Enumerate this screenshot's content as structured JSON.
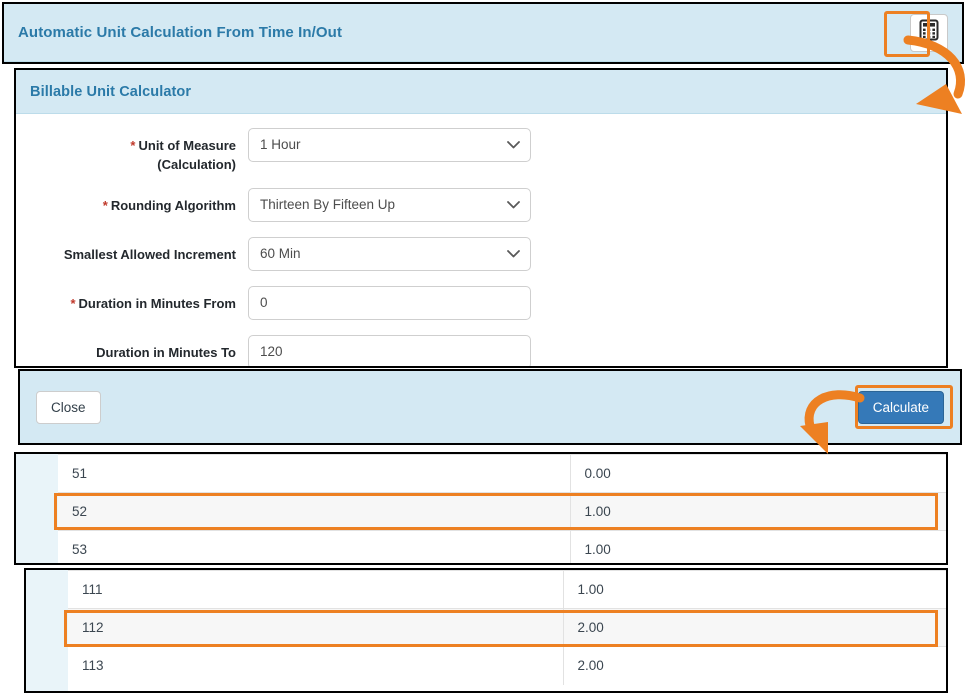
{
  "header": {
    "title": "Automatic Unit Calculation From Time In/Out",
    "calculator_icon": "calculator-icon"
  },
  "dialog": {
    "title": "Billable Unit Calculator",
    "fields": [
      {
        "label": "Unit of Measure (Calculation)",
        "label_line1": "Unit of Measure",
        "label_line2": "(Calculation)",
        "required": true,
        "type": "select",
        "value": "1 Hour"
      },
      {
        "label": "Rounding Algorithm",
        "label_line1": "Rounding Algorithm",
        "label_line2": "",
        "required": true,
        "type": "select",
        "value": "Thirteen By Fifteen Up"
      },
      {
        "label": "Smallest Allowed Increment",
        "label_line1": "Smallest Allowed Increment",
        "label_line2": "",
        "required": false,
        "type": "select",
        "value": "60 Min"
      },
      {
        "label": "Duration in Minutes From",
        "label_line1": "Duration in Minutes From",
        "label_line2": "",
        "required": true,
        "type": "text",
        "value": "0"
      },
      {
        "label": "Duration in Minutes To",
        "label_line1": "Duration in Minutes To",
        "label_line2": "",
        "required": false,
        "type": "text",
        "value": "120"
      }
    ],
    "required_marker": "*",
    "footer": {
      "close_label": "Close",
      "calculate_label": "Calculate"
    }
  },
  "results_top": {
    "rows": [
      {
        "minutes": "51",
        "units": "0.00",
        "highlighted": false
      },
      {
        "minutes": "52",
        "units": "1.00",
        "highlighted": true
      },
      {
        "minutes": "53",
        "units": "1.00",
        "highlighted": false
      }
    ]
  },
  "results_bottom": {
    "rows": [
      {
        "minutes": "111",
        "units": "1.00",
        "highlighted": false
      },
      {
        "minutes": "112",
        "units": "2.00",
        "highlighted": true
      },
      {
        "minutes": "113",
        "units": "2.00",
        "highlighted": false
      }
    ]
  },
  "annotations": {
    "accent_color": "#ed8022",
    "arrows": [
      {
        "name": "arrow-from-calculator-icon-to-dialog"
      },
      {
        "name": "arrow-from-calculate-button-to-results"
      }
    ]
  },
  "colors": {
    "titlebar_bg": "#d4e9f3",
    "title_text": "#2b7aa8",
    "primary_button": "#3579b8",
    "highlight": "#ed8022"
  }
}
